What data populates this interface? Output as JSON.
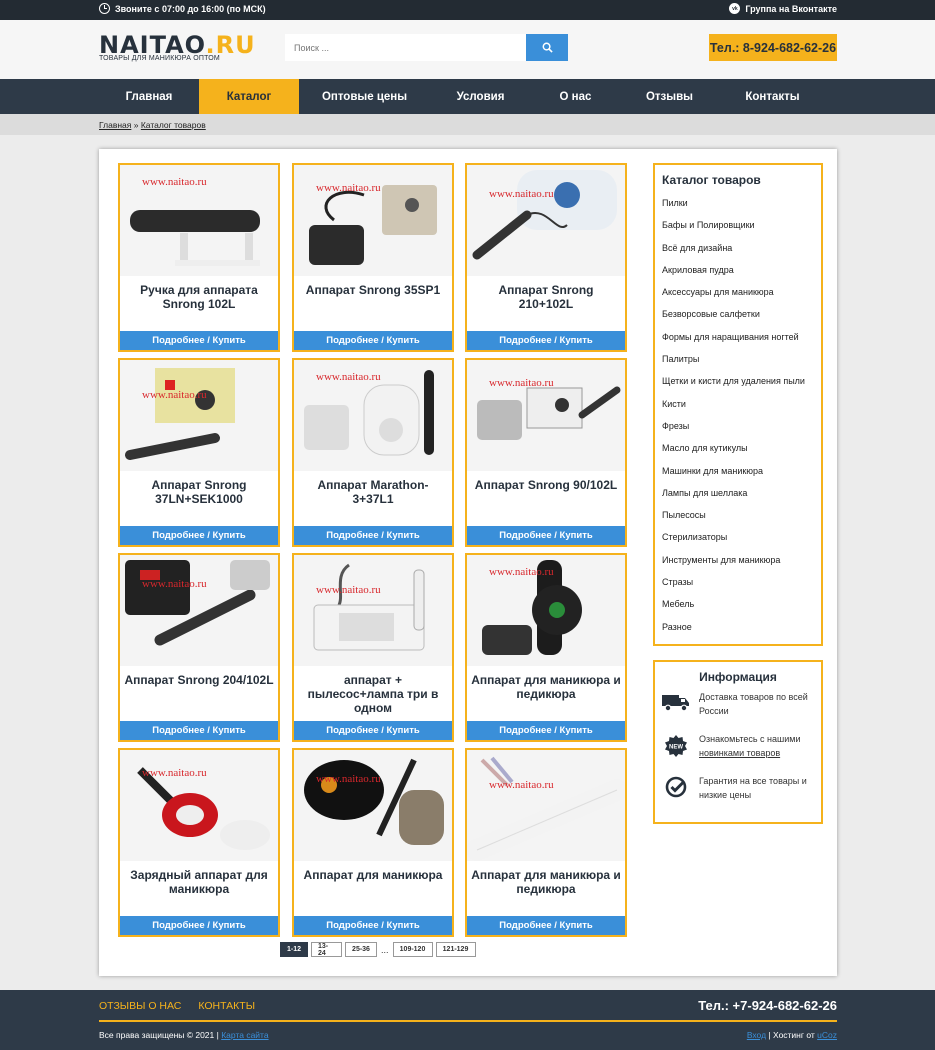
{
  "topbar": {
    "hours_text": "Звоните с 07:00 до 16:00 (по МСК)",
    "vk_text": "Группа на Вконтакте",
    "clock_icon": "clock-icon",
    "vk_icon": "vk-icon"
  },
  "header": {
    "logo_main": "NAITAO",
    "logo_suffix": ".RU",
    "logo_sub": "ТОВАРЫ ДЛЯ МАНИКЮРА ОПТОМ",
    "search_placeholder": "Поиск ...",
    "phone": "Тел.: 8-924-682-62-26"
  },
  "nav": {
    "items": [
      {
        "label": "Главная"
      },
      {
        "label": "Каталог"
      },
      {
        "label": "Оптовые цены"
      },
      {
        "label": "Условия"
      },
      {
        "label": "О нас"
      },
      {
        "label": "Отзывы"
      },
      {
        "label": "Контакты"
      }
    ]
  },
  "breadcrumb": {
    "home": "Главная",
    "sep": "»",
    "current": "Каталог товаров"
  },
  "products": [
    {
      "title": "Ручка для аппарата Snrong 102L",
      "button": "Подробнее / Купить",
      "watermark": "www.naitao.ru"
    },
    {
      "title": "Аппарат Snrong 35SP1",
      "button": "Подробнее / Купить",
      "watermark": "www.naitao.ru"
    },
    {
      "title": "Аппарат Snrong 210+102L",
      "button": "Подробнее / Купить",
      "watermark": "www.naitao.ru"
    },
    {
      "title": "Аппарат Snrong 37LN+SEK1000",
      "button": "Подробнее / Купить",
      "watermark": "www.naitao.ru"
    },
    {
      "title": "Аппарат Marathon-3+37L1",
      "button": "Подробнее / Купить",
      "watermark": "www.naitao.ru"
    },
    {
      "title": "Аппарат Snrong 90/102L",
      "button": "Подробнее / Купить",
      "watermark": "www.naitao.ru"
    },
    {
      "title": "Аппарат Snrong 204/102L",
      "button": "Подробнее / Купить",
      "watermark": "www.naitao.ru"
    },
    {
      "title": "аппарат + пылесос+лампа три в одном",
      "button": "Подробнее / Купить",
      "watermark": "www.naitao.ru"
    },
    {
      "title": "Аппарат для маникюра и педикюра",
      "button": "Подробнее / Купить",
      "watermark": "www.naitao.ru"
    },
    {
      "title": "Зарядный аппарат для маникюра",
      "button": "Подробнее / Купить",
      "watermark": "www.naitao.ru"
    },
    {
      "title": "Аппарат для маникюра",
      "button": "Подробнее / Купить",
      "watermark": "www.naitao.ru"
    },
    {
      "title": "Аппарат для маникюра и педикюра",
      "button": "Подробнее / Купить",
      "watermark": "www.naitao.ru"
    }
  ],
  "pagination": {
    "pages": [
      "1-12",
      "13-24",
      "25-36",
      "109-120",
      "121-129"
    ],
    "ellipsis": "..."
  },
  "catalog": {
    "title": "Каталог товаров",
    "items": [
      "Пилки",
      "Бафы и Полировщики",
      "Всё для дизайна",
      "Акриловая пудра",
      "Аксессуары для маникюра",
      "Безворсовые салфетки",
      "Формы для наращивания ногтей",
      "Палитры",
      "Щетки и кисти для удаления пыли",
      "Кисти",
      "Фрезы",
      "Масло для кутикулы",
      "Машинки для маникюра",
      "Лампы для шеллака",
      "Пылесосы",
      "Стерилизаторы",
      "Инструменты для маникюра",
      "Стразы",
      "Мебель",
      "Разное"
    ]
  },
  "info": {
    "title": "Информация",
    "delivery": "Доставка товаров по всей России",
    "news_prefix": "Ознакомьтесь с нашими",
    "news_link": "новинками товаров",
    "news_badge": "NEW",
    "guarantee": "Гарантия на все товары и низкие цены"
  },
  "footer": {
    "links": [
      "ОТЗЫВЫ О НАС",
      "КОНТАКТЫ"
    ],
    "phone": "Тел.: +7-924-682-62-26",
    "copyright": "Все права защищены © 2021 |",
    "sitemap": "Карта сайта",
    "login": "Вход",
    "hosting": "| Хостинг от",
    "ucoz": "uCoz"
  },
  "colors": {
    "accent": "#f5b21c",
    "nav_bg": "#2e3a48",
    "button_blue": "#3a8fd9"
  }
}
